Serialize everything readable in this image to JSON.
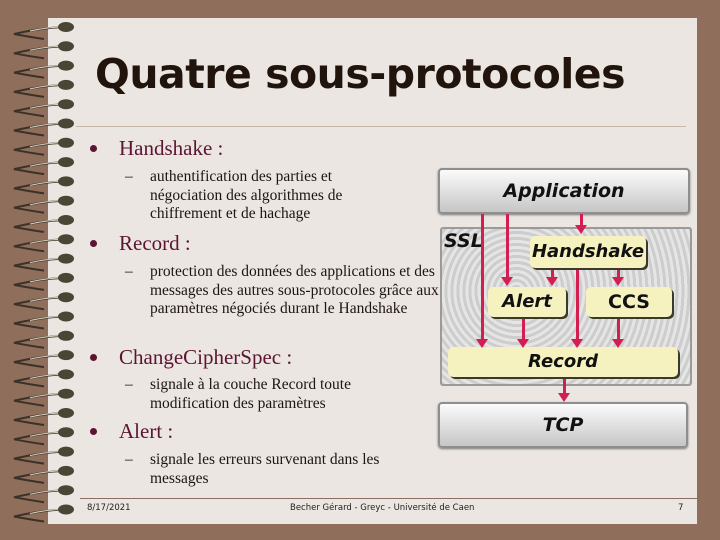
{
  "slide": {
    "title": "Quatre sous-protocoles",
    "bullets": [
      {
        "heading": "Handshake :",
        "text": "authentification des parties et négociation des algorithmes de chiffrement et de hachage"
      },
      {
        "heading": "Record :",
        "text": "protection des données des applications et des messages des autres sous-protocoles grâce aux paramètres négociés durant le Handshake"
      },
      {
        "heading": "ChangeCipherSpec :",
        "text": "signale à la couche Record toute modification des paramètres"
      },
      {
        "heading": "Alert :",
        "text": "signale les erreurs survenant dans les messages"
      }
    ],
    "dash": "–",
    "footer": {
      "date": "8/17/2021",
      "author": "Becher Gérard - Greyc - Université de Caen",
      "page_number": "7"
    }
  },
  "diagram": {
    "application": "Application",
    "ssl": "SSL",
    "handshake": "Handshake",
    "alert": "Alert",
    "ccs": "CCS",
    "record": "Record",
    "tcp": "TCP",
    "colors": {
      "arrow": "#d21e50",
      "box": "#f6f2bf",
      "bullet": "#5b1432"
    }
  }
}
